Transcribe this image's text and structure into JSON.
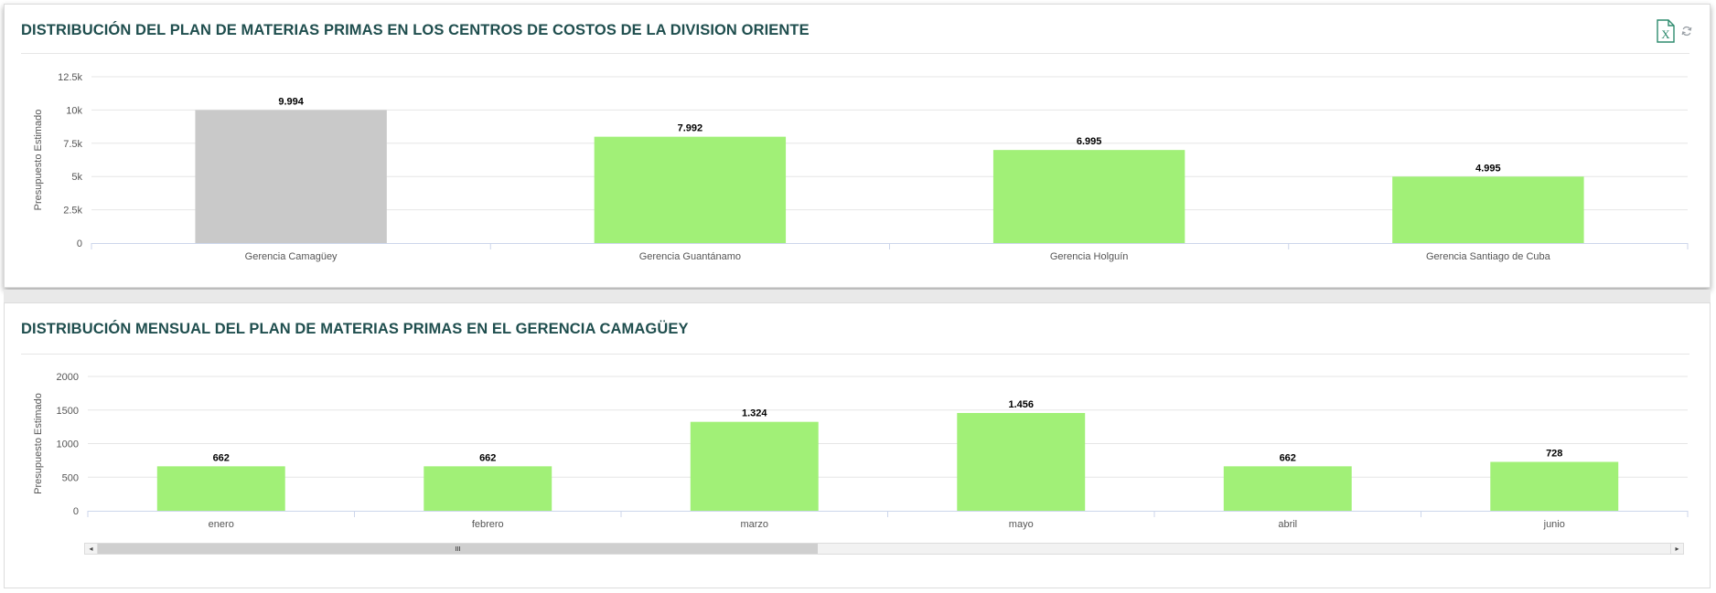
{
  "charts_meta": {
    "title_1": "DISTRIBUCIÓN DEL PLAN DE MATERIAS PRIMAS EN LOS CENTROS DE COSTOS DE LA DIVISION ORIENTE",
    "title_2": "DISTRIBUCIÓN MENSUAL DEL PLAN DE MATERIAS PRIMAS EN EL GERENCIA CAMAGÜEY"
  },
  "toolbar": {
    "excel_icon": "excel-export-icon",
    "refresh_icon": "refresh-icon",
    "excel_color": "#2e8b6e",
    "refresh_color": "#9aa0a6"
  },
  "scrollbar": {
    "left_arrow": "◂",
    "right_arrow": "▸",
    "position_fraction": 0.0,
    "visible_fraction": 0.45
  },
  "colors": {
    "bar": "#a1f077",
    "bar_selected": "#c9c9c9",
    "title": "#1f4e4e",
    "axis_text": "#555555",
    "grid": "#e6e6e6",
    "axis_line": "#ccd6eb"
  },
  "chart_data": [
    {
      "type": "bar",
      "title": "DISTRIBUCIÓN DEL PLAN DE MATERIAS PRIMAS EN LOS CENTROS DE COSTOS DE LA DIVISION ORIENTE",
      "xlabel": "",
      "ylabel": "Presupuesto Estimado",
      "ylim": [
        0,
        12500
      ],
      "yticks": [
        0,
        2500,
        5000,
        7500,
        10000,
        12500
      ],
      "ytick_labels": [
        "0",
        "2.5k",
        "5k",
        "7.5k",
        "10k",
        "12.5k"
      ],
      "categories": [
        "Gerencia Camagüey",
        "Gerencia Guantánamo",
        "Gerencia Holguín",
        "Gerencia Santiago de Cuba"
      ],
      "values": [
        9994,
        7992,
        6995,
        4995
      ],
      "data_labels": [
        "9.994",
        "7.992",
        "6.995",
        "4.995"
      ],
      "selected_index": 0,
      "grid": true,
      "legend": "none"
    },
    {
      "type": "bar",
      "title": "DISTRIBUCIÓN MENSUAL DEL PLAN DE MATERIAS PRIMAS EN EL GERENCIA CAMAGÜEY",
      "xlabel": "",
      "ylabel": "Presupuesto Estimado",
      "ylim": [
        0,
        2000
      ],
      "yticks": [
        0,
        500,
        1000,
        1500,
        2000
      ],
      "ytick_labels": [
        "0",
        "500",
        "1000",
        "1500",
        "2000"
      ],
      "categories": [
        "enero",
        "febrero",
        "marzo",
        "mayo",
        "abril",
        "junio"
      ],
      "values": [
        662,
        662,
        1324,
        1456,
        662,
        728
      ],
      "data_labels": [
        "662",
        "662",
        "1.324",
        "1.456",
        "662",
        "728"
      ],
      "grid": true,
      "legend": "none"
    }
  ]
}
